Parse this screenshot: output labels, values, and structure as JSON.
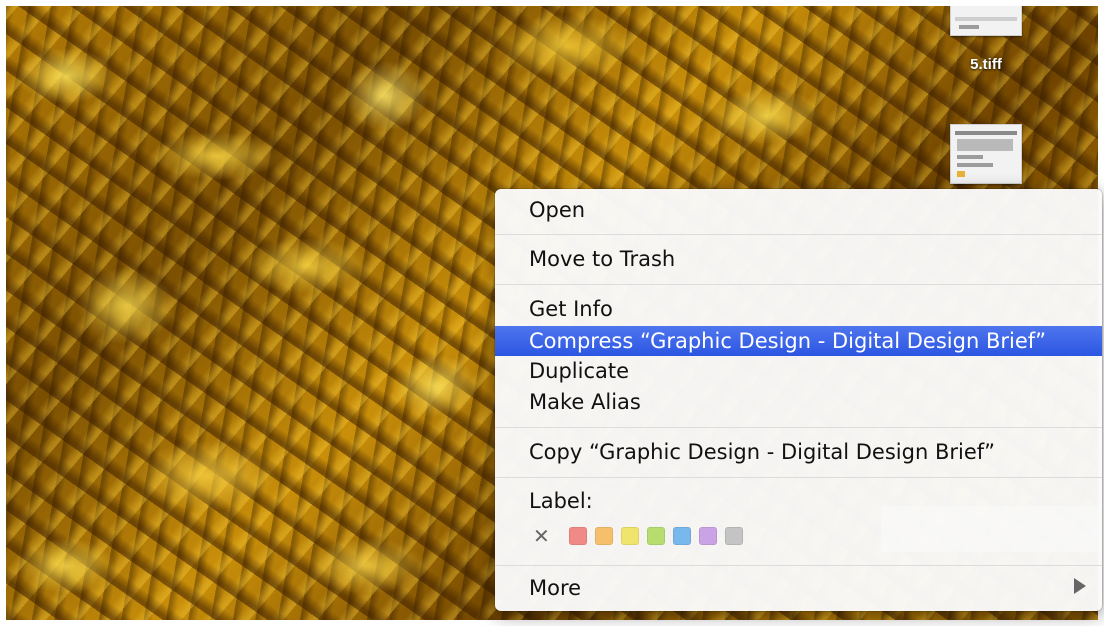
{
  "desktop": {
    "files": [
      {
        "name": "",
        "icon": "document-thumbnail-icon"
      },
      {
        "name": "5.tiff",
        "icon": "image-thumbnail-icon"
      }
    ]
  },
  "context_menu": {
    "items": {
      "open": "Open",
      "move_to_trash": "Move to Trash",
      "get_info": "Get Info",
      "compress": "Compress “Graphic Design - Digital Design Brief”",
      "duplicate": "Duplicate",
      "make_alias": "Make Alias",
      "copy": "Copy “Graphic Design - Digital Design Brief”",
      "more": "More"
    },
    "highlighted_item": "compress",
    "label_section": {
      "heading": "Label:",
      "none_symbol": "✕",
      "colors": [
        {
          "name": "red",
          "hex": "#f08a86"
        },
        {
          "name": "orange",
          "hex": "#f5bf6b"
        },
        {
          "name": "yellow",
          "hex": "#f1e46d"
        },
        {
          "name": "green",
          "hex": "#b6dd6e"
        },
        {
          "name": "blue",
          "hex": "#79b8ec"
        },
        {
          "name": "purple",
          "hex": "#c9a3e5"
        },
        {
          "name": "gray",
          "hex": "#c4c4c4"
        }
      ]
    },
    "more_icon": "submenu-arrow-icon"
  },
  "colors": {
    "highlight": "#3563e9",
    "menu_background": "#fafafa",
    "desktop_gold": "#b57d06"
  }
}
